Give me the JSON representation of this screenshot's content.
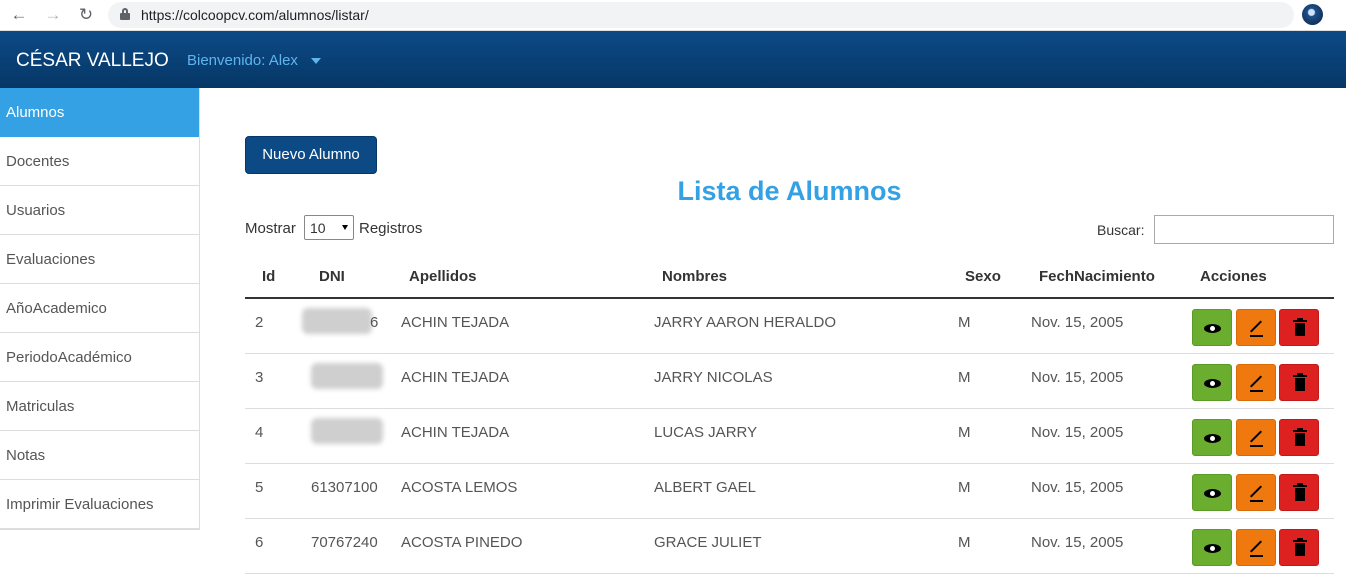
{
  "browser": {
    "url": "https://colcoopcv.com/alumnos/listar/"
  },
  "navbar": {
    "brand": "CÉSAR VALLEJO",
    "welcome": "Bienvenido: Alex"
  },
  "sidebar": {
    "items": [
      {
        "label": "Alumnos",
        "active": true
      },
      {
        "label": "Docentes"
      },
      {
        "label": "Usuarios"
      },
      {
        "label": "Evaluaciones"
      },
      {
        "label": "AñoAcademico"
      },
      {
        "label": "PeriodoAcadémico"
      },
      {
        "label": "Matriculas"
      },
      {
        "label": "Notas"
      },
      {
        "label": "Imprimir Evaluaciones"
      }
    ]
  },
  "main": {
    "new_button": "Nuevo Alumno",
    "title": "Lista de Alumnos",
    "show_label": "Mostrar",
    "page_size": "10",
    "records_label": "Registros",
    "search_label": "Buscar:",
    "search_value": ""
  },
  "table": {
    "columns": [
      "Id",
      "DNI",
      "Apellidos",
      "Nombres",
      "Sexo",
      "FechNacimiento",
      "Acciones"
    ],
    "rows": [
      {
        "id": "2",
        "dni": "6",
        "apellidos": "ACHIN TEJADA",
        "nombres": "JARRY AARON HERALDO",
        "sexo": "M",
        "fecha": "Nov. 15, 2005"
      },
      {
        "id": "3",
        "dni": "",
        "apellidos": "ACHIN TEJADA",
        "nombres": "JARRY NICOLAS",
        "sexo": "M",
        "fecha": "Nov. 15, 2005"
      },
      {
        "id": "4",
        "dni": "",
        "apellidos": "ACHIN TEJADA",
        "nombres": "LUCAS JARRY",
        "sexo": "M",
        "fecha": "Nov. 15, 2005"
      },
      {
        "id": "5",
        "dni": "61307100",
        "apellidos": "ACOSTA LEMOS",
        "nombres": "ALBERT GAEL",
        "sexo": "M",
        "fecha": "Nov. 15, 2005"
      },
      {
        "id": "6",
        "dni": "70767240",
        "apellidos": "ACOSTA PINEDO",
        "nombres": "GRACE JULIET",
        "sexo": "M",
        "fecha": "Nov. 15, 2005"
      }
    ]
  },
  "colors": {
    "navbar": "#0c4a86",
    "accent": "#33a1e3",
    "view": "#6aad2f",
    "edit": "#f0790f",
    "delete": "#dd2020"
  },
  "icons": {
    "view": "eye-icon",
    "edit": "pencil-icon",
    "delete": "trash-icon"
  }
}
